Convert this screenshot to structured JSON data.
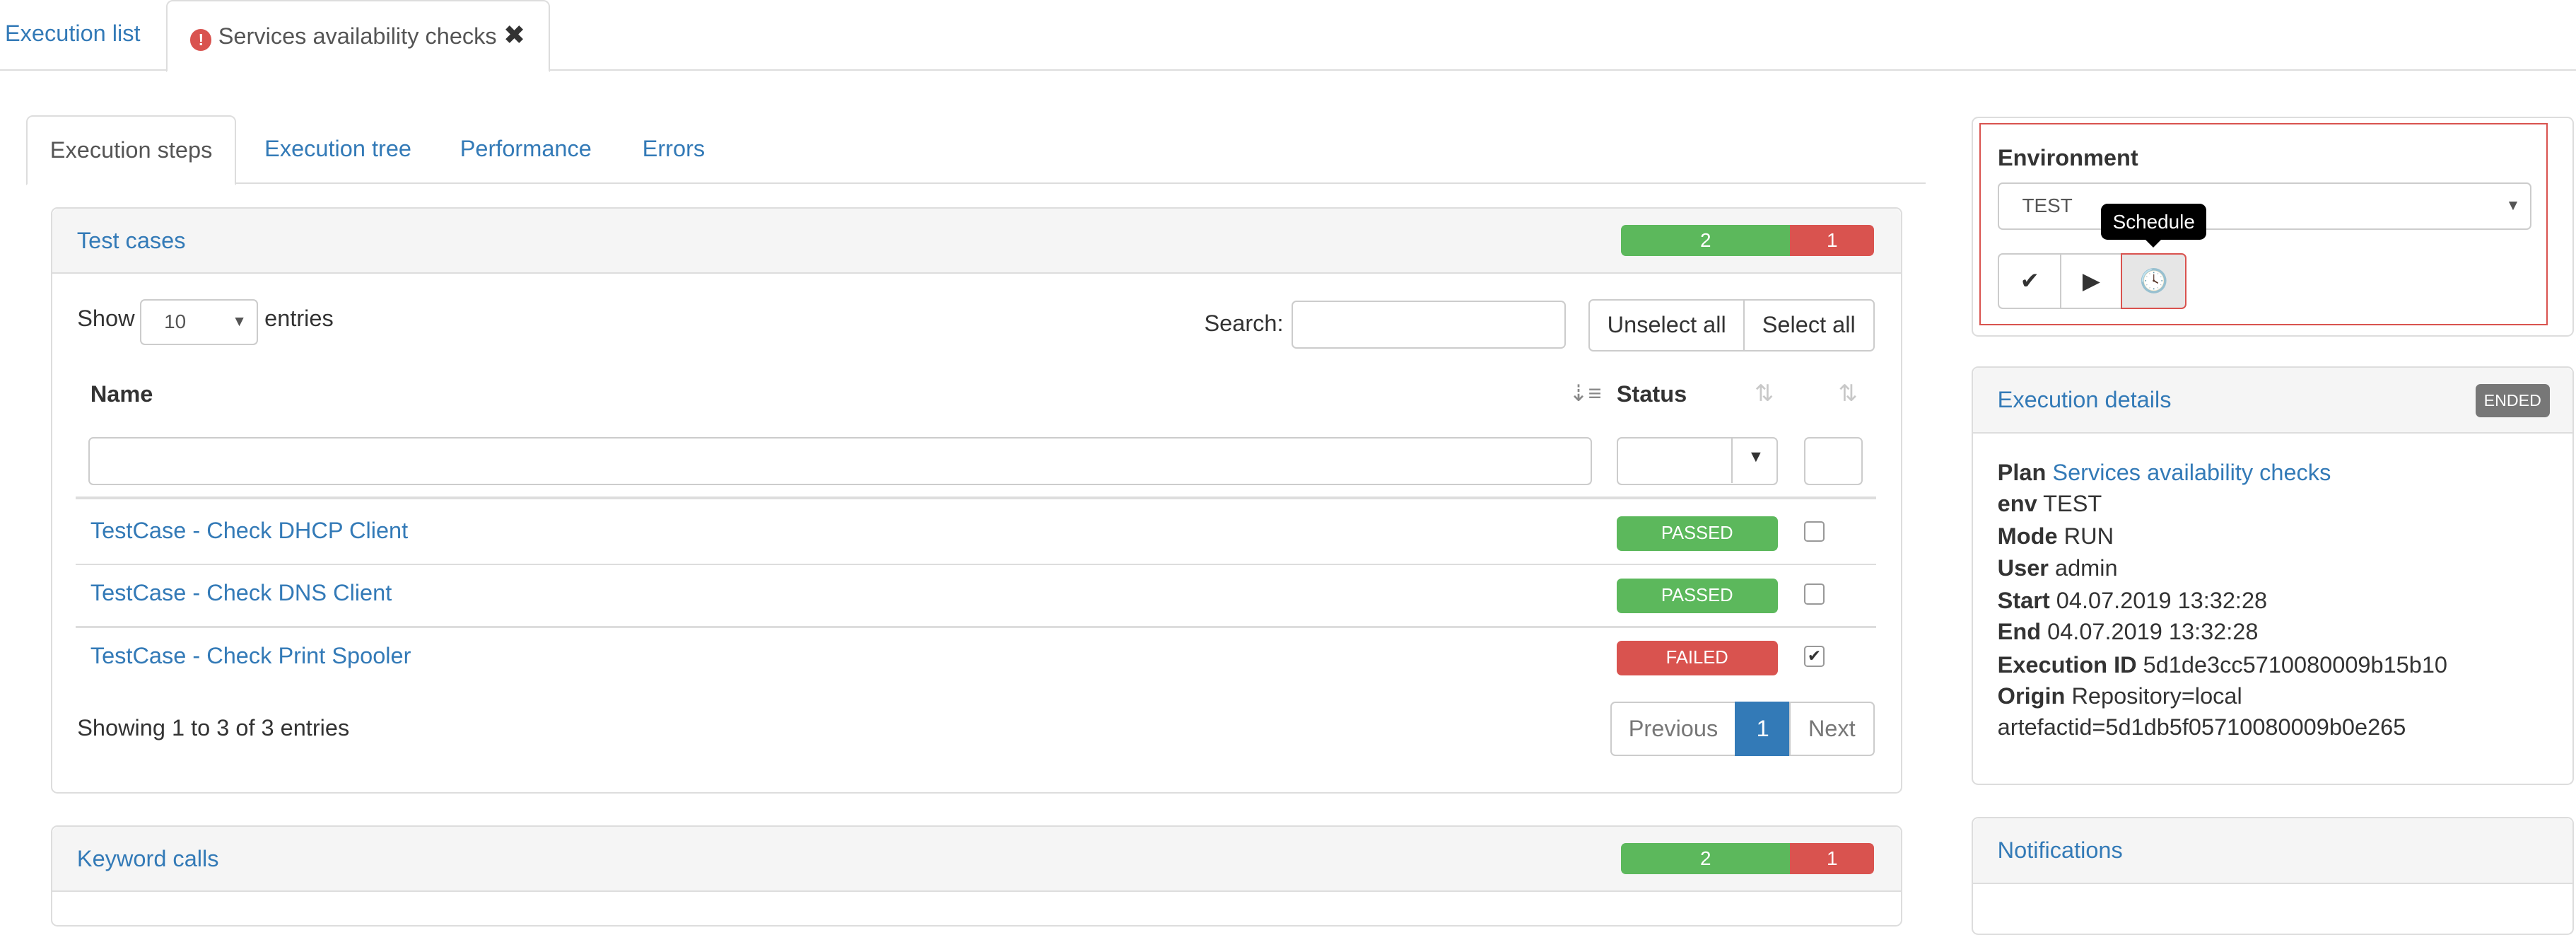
{
  "top_tabs": {
    "execution_list": "Execution list",
    "active_title": "Services availability checks"
  },
  "inner_tabs": [
    {
      "label": "Execution steps"
    },
    {
      "label": "Execution tree"
    },
    {
      "label": "Performance"
    },
    {
      "label": "Errors"
    }
  ],
  "test_cases": {
    "title": "Test cases",
    "passed_count": "2",
    "failed_count": "1",
    "passed_fraction": 0.667,
    "show_label": "Show",
    "page_size": "10",
    "entries_label": "entries",
    "search_label": "Search:",
    "unselect_all": "Unselect all",
    "select_all": "Select all",
    "columns": {
      "name": "Name",
      "status": "Status"
    },
    "rows": [
      {
        "name": "TestCase - Check DHCP Client",
        "status": "PASSED",
        "checked": false
      },
      {
        "name": "TestCase - Check DNS Client",
        "status": "PASSED",
        "checked": false
      },
      {
        "name": "TestCase - Check Print Spooler",
        "status": "FAILED",
        "checked": true
      }
    ],
    "showing": "Showing 1 to 3 of 3 entries",
    "pagination": {
      "previous": "Previous",
      "page": "1",
      "next": "Next"
    }
  },
  "keyword_calls": {
    "title": "Keyword calls",
    "passed_count": "2",
    "failed_count": "1"
  },
  "environment": {
    "label": "Environment",
    "selected": "TEST",
    "tooltip": "Schedule"
  },
  "execution_details": {
    "title": "Execution details",
    "badge": "ENDED",
    "plan_label": "Plan",
    "plan_value": "Services availability checks",
    "env_label": "env",
    "env_value": "TEST",
    "mode_label": "Mode",
    "mode_value": "RUN",
    "user_label": "User",
    "user_value": "admin",
    "start_label": "Start",
    "start_value": "04.07.2019 13:32:28",
    "end_label": "End",
    "end_value": "04.07.2019 13:32:28",
    "exec_id_label": "Execution ID",
    "exec_id_value": "5d1de3cc5710080009b15b10",
    "origin_label": "Origin",
    "origin_value": "Repository=local",
    "origin_value2": "artefactid=5d1db5f05710080009b0e265"
  },
  "notifications": {
    "title": "Notifications"
  },
  "colors": {
    "link": "#337ab7",
    "passed": "#5cb85c",
    "failed": "#d9534f",
    "highlight": "#d9534f"
  }
}
